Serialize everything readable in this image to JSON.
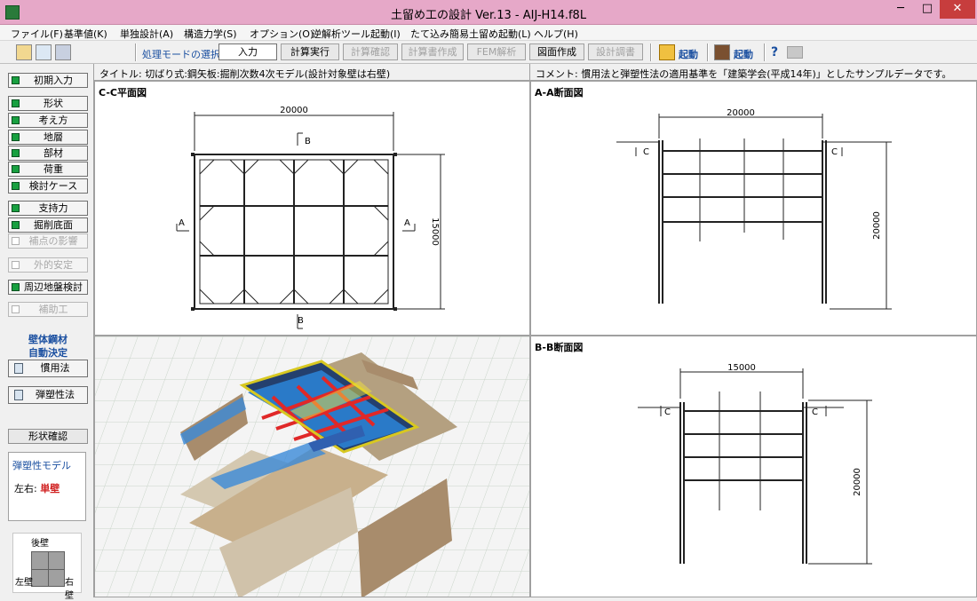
{
  "window": {
    "title": "土留め工の設計 Ver.13 - AIJ-H14.f8L",
    "min": "─",
    "max": "□",
    "close": "✕"
  },
  "menu": [
    "ファイル(F)",
    "基準値(K)",
    "単独設計(A)",
    "構造力学(S)",
    "オプション(O)",
    "逆解析ツール起動(I)",
    "たて込み簡易土留め起動(L)",
    "ヘルプ(H)"
  ],
  "toolbar": {
    "mode_label": "処理モードの選択",
    "buttons": [
      "入力",
      "計算実行",
      "計算確認",
      "計算書作成",
      "FEM解析",
      "図面作成",
      "設計調書"
    ],
    "launch1": "起動",
    "launch2": "起動",
    "help": "?"
  },
  "sidebar": {
    "items": [
      {
        "label": "初期入力",
        "enabled": true
      },
      {
        "label": "形状",
        "enabled": true
      },
      {
        "label": "考え方",
        "enabled": true
      },
      {
        "label": "地層",
        "enabled": true
      },
      {
        "label": "部材",
        "enabled": true
      },
      {
        "label": "荷重",
        "enabled": true
      },
      {
        "label": "検討ケース",
        "enabled": true
      },
      {
        "label": "支持力",
        "enabled": true
      },
      {
        "label": "掘削底面",
        "enabled": true
      },
      {
        "label": "補点の影響",
        "enabled": false
      },
      {
        "label": "外的安定",
        "enabled": false
      },
      {
        "label": "周辺地盤検討",
        "enabled": true
      },
      {
        "label": "補助工",
        "enabled": false
      }
    ],
    "auto_label_1": "壁体鋼材",
    "auto_label_2": "自動決定",
    "calc1": "慣用法",
    "calc2": "弾塑性法",
    "shape_confirm": "形状確認",
    "model_title": "弾塑性モデル",
    "model_lr_label": "左右:",
    "model_lr_value": "単壁",
    "compass_top": "後壁",
    "compass_left": "左壁",
    "compass_right": "右壁"
  },
  "info": {
    "title": "タイトル: 切ばり式:鋼矢板:掘削次数4次モデル(設計対象壁は右壁)",
    "comment": "コメント: 慣用法と弾塑性法の適用基準を「建築学会(平成14年)」としたサンプルデータです。"
  },
  "panes": {
    "cc": {
      "label": "C-C平面図",
      "dim_width": "20000",
      "dim_height": "15000",
      "sec_a": "A",
      "sec_b": "B"
    },
    "aa": {
      "label": "A-A断面図",
      "dim_width": "20000",
      "dim_height": "20000",
      "sec_c": "C"
    },
    "bb": {
      "label": "B-B断面図",
      "dim_width": "15000",
      "dim_height": "20000",
      "sec_c": "C"
    }
  },
  "colors": {
    "titlebar": "#e6a8c8",
    "close": "#c73d3d",
    "indicator": "#18a040",
    "accent": "#1a4fa0"
  }
}
